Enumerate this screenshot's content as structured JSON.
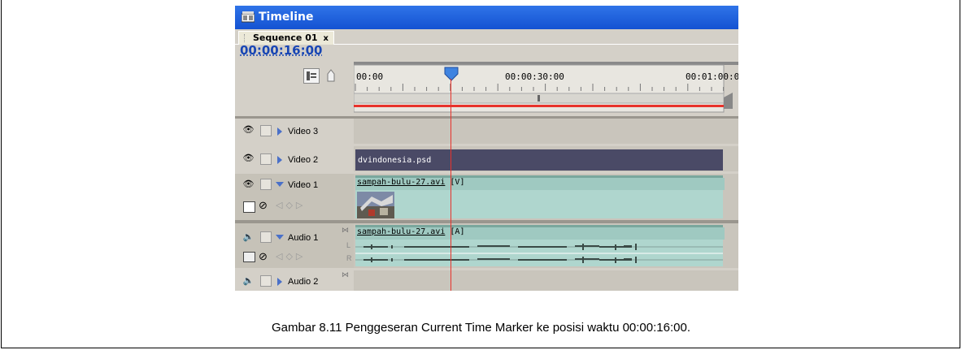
{
  "window": {
    "title": "Timeline"
  },
  "tabs": [
    {
      "label": "Sequence 01",
      "close": "x"
    }
  ],
  "current_time": "00:00:16:00",
  "ruler": {
    "labels": [
      "00:00",
      "00:00:30:00",
      "00:01:00:0"
    ]
  },
  "tracks": [
    {
      "name": "Video 3",
      "clip": ""
    },
    {
      "name": "Video 2",
      "clip": "dvindonesia.psd"
    },
    {
      "name": "Video 1",
      "clip": "sampah-bulu-27.avi",
      "clip_suffix": "[V]"
    },
    {
      "name": "Audio 1",
      "clip": "sampah-bulu-27.avi",
      "clip_suffix": "[A]",
      "channels": [
        "L",
        "R"
      ]
    },
    {
      "name": "Audio 2",
      "clip": ""
    }
  ],
  "colors": {
    "title_bar": "#1e5fd8",
    "timecode": "#1846b4",
    "cti_line": "#e8322b",
    "psd_clip": "#4a4a66",
    "av_clip": "#a9d0c8"
  },
  "caption": "Gambar 8.11 Penggeseran Current Time Marker ke posisi waktu 00:00:16:00."
}
